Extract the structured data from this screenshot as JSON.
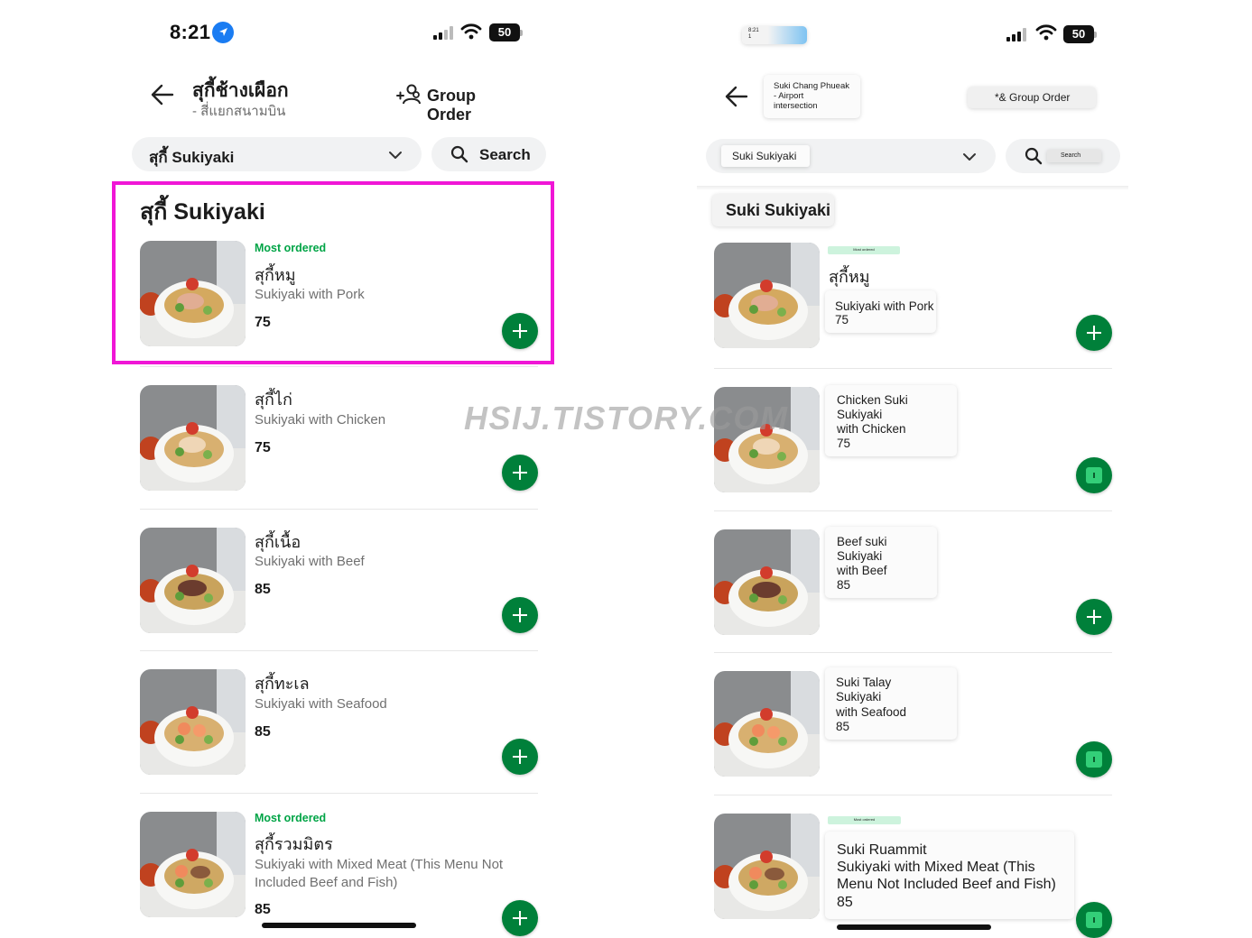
{
  "left": {
    "status": {
      "time": "8:21",
      "battery": "50"
    },
    "header": {
      "shop_name": "สุกี้ช้างเผือก",
      "branch": "- สี่แยกสนามบิน",
      "group_order": "Group Order"
    },
    "category_dropdown": {
      "value": "สุกี้ Sukiyaki"
    },
    "search": {
      "label": "Search"
    },
    "category_title": "สุกี้ Sukiyaki",
    "items": [
      {
        "badge": "Most ordered",
        "name": "สุกี้หมู",
        "desc": "Sukiyaki with Pork",
        "price": "75"
      },
      {
        "badge": "",
        "name": "สุกี้ไก่",
        "desc": "Sukiyaki with Chicken",
        "price": "75"
      },
      {
        "badge": "",
        "name": "สุกี้เนื้อ",
        "desc": "Sukiyaki with Beef",
        "price": "85"
      },
      {
        "badge": "",
        "name": "สุกี้ทะเล",
        "desc": "Sukiyaki with Seafood",
        "price": "85"
      },
      {
        "badge": "Most ordered",
        "name": "สุกี้รวมมิตร",
        "desc": "Sukiyaki with Mixed Meat (This Menu Not Included Beef and Fish)",
        "price": "85"
      }
    ]
  },
  "right": {
    "status": {
      "time": "8:21",
      "time_sub": "1",
      "battery": "50"
    },
    "header": {
      "shop_name": "Suki Chang Phueak",
      "branch": "- Airport",
      "branch2": "intersection",
      "group_order": "*& Group Order"
    },
    "category_dropdown": {
      "value": "Suki Sukiyaki"
    },
    "search": {
      "label": "Search"
    },
    "category_title": "Suki Sukiyaki",
    "items": [
      {
        "badge": "Most ordered",
        "name": "สุกี้หมู",
        "lines": [
          "Sukiyaki with Pork",
          "75"
        ]
      },
      {
        "badge": "",
        "name": "",
        "lines": [
          "Chicken Suki",
          "Sukiyaki",
          "with Chicken",
          "75"
        ]
      },
      {
        "badge": "",
        "name": "",
        "lines": [
          "Beef suki",
          "Sukiyaki",
          "with Beef",
          "85"
        ]
      },
      {
        "badge": "",
        "name": "",
        "lines": [
          "Suki Talay",
          "Sukiyaki",
          "with Seafood",
          "85"
        ]
      },
      {
        "badge": "Most ordered",
        "name": "",
        "lines": [
          "Suki Ruammit",
          "Sukiyaki with Mixed Meat (This",
          "Menu Not Included Beef and Fish)",
          "85"
        ]
      }
    ]
  },
  "watermark": "HSIJ.TISTORY.COM",
  "colors": {
    "accent_green": "#00a446",
    "add_button": "#00803a",
    "highlight": "#f016d6"
  }
}
